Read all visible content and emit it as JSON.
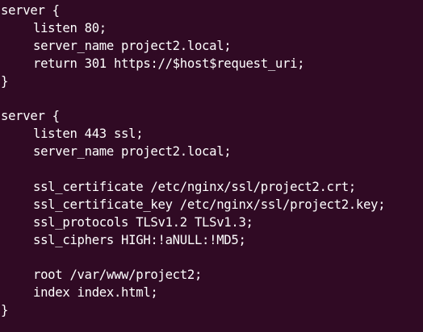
{
  "theme": {
    "background": "#300a24",
    "foreground": "#ffffff"
  },
  "code_lines": [
    {
      "text": "server {",
      "indent": 0
    },
    {
      "text": "listen 80;",
      "indent": 1
    },
    {
      "text": "server_name project2.local;",
      "indent": 1
    },
    {
      "text": "return 301 https://$host$request_uri;",
      "indent": 1
    },
    {
      "text": "}",
      "indent": 0
    },
    {
      "text": "",
      "indent": 0
    },
    {
      "text": "server {",
      "indent": 0
    },
    {
      "text": "listen 443 ssl;",
      "indent": 1
    },
    {
      "text": "server_name project2.local;",
      "indent": 1
    },
    {
      "text": "",
      "indent": 0
    },
    {
      "text": "ssl_certificate /etc/nginx/ssl/project2.crt;",
      "indent": 1
    },
    {
      "text": "ssl_certificate_key /etc/nginx/ssl/project2.key;",
      "indent": 1
    },
    {
      "text": "ssl_protocols TLSv1.2 TLSv1.3;",
      "indent": 1
    },
    {
      "text": "ssl_ciphers HIGH:!aNULL:!MD5;",
      "indent": 1
    },
    {
      "text": "",
      "indent": 0
    },
    {
      "text": "root /var/www/project2;",
      "indent": 1
    },
    {
      "text": "index index.html;",
      "indent": 1
    },
    {
      "text": "}",
      "indent": 0
    }
  ]
}
